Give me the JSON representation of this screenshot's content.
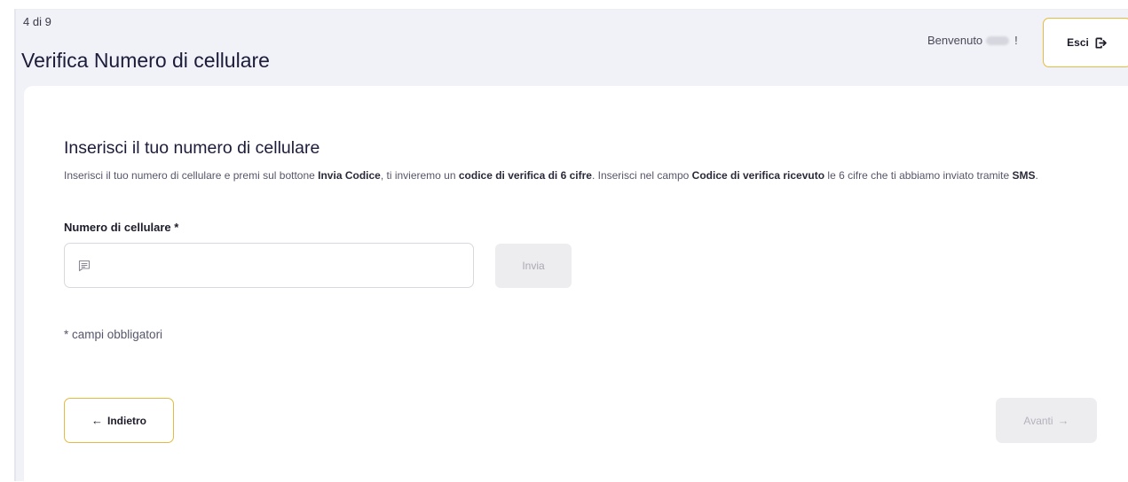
{
  "header": {
    "step": "4 di 9",
    "title": "Verifica Numero di cellulare",
    "welcome_prefix": "Benvenuto",
    "welcome_suffix": "!",
    "logout_label": "Esci"
  },
  "form": {
    "heading": "Inserisci il tuo numero di cellulare",
    "description": {
      "p1": "Inserisci il tuo numero di cellulare e premi sul bottone ",
      "b1": "Invia Codice",
      "p2": ", ti invieremo un ",
      "b2": "codice di verifica di 6 cifre",
      "p3": ". Inserisci nel campo ",
      "b3": "Codice di verifica ricevuto",
      "p4": " le 6 cifre che ti abbiamo inviato tramite ",
      "b4": "SMS",
      "p5": "."
    },
    "phone_label": "Numero di cellulare *",
    "phone_value": "",
    "send_label": "Invia",
    "required_note": "* campi obbligatori"
  },
  "nav": {
    "back_arrow": "←",
    "back_label": "Indietro",
    "next_label": "Avanti",
    "next_arrow": "→"
  },
  "colors": {
    "accent_border": "#e3bb3f",
    "header_bg": "#f1f2f8",
    "disabled_bg": "#ededf0"
  },
  "icons": {
    "logout": "logout-icon",
    "phone_field": "message-icon"
  }
}
